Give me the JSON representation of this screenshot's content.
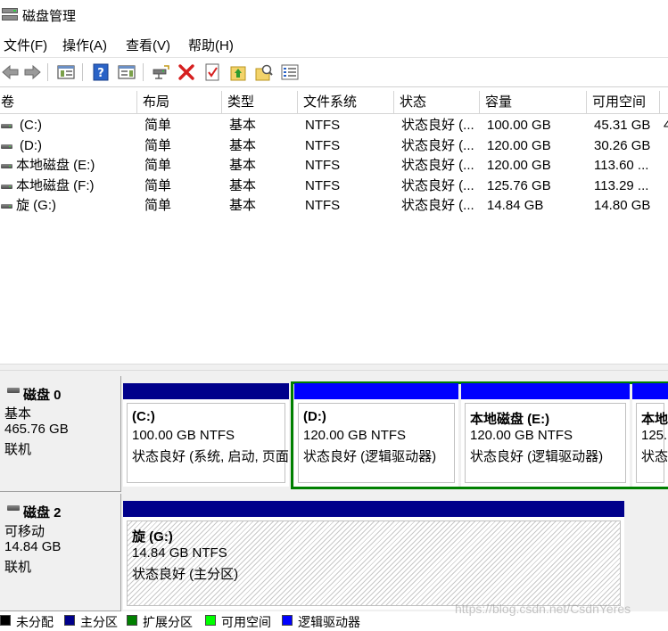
{
  "window": {
    "title": "磁盘管理"
  },
  "menu": [
    "文件(F)",
    "操作(A)",
    "查看(V)",
    "帮助(H)"
  ],
  "toolbar_icons": [
    "back-arrow-icon",
    "forward-arrow-icon",
    "console-tree-icon",
    "help-icon",
    "action-pane-icon",
    "connect-drive-icon",
    "delete-icon",
    "properties-check-icon",
    "up-arrow-folder-icon",
    "search-folder-icon",
    "list-view-icon"
  ],
  "columns": [
    "卷",
    "布局",
    "类型",
    "文件系统",
    "状态",
    "容量",
    "可用空间",
    ""
  ],
  "volumes": [
    {
      "name": "(C:)",
      "layout": "简单",
      "type": "基本",
      "fs": "NTFS",
      "status": "状态良好 (...",
      "capacity": "100.00 GB",
      "free": "45.31 GB",
      "pct": "4"
    },
    {
      "name": "(D:)",
      "layout": "简单",
      "type": "基本",
      "fs": "NTFS",
      "status": "状态良好 (...",
      "capacity": "120.00 GB",
      "free": "30.26 GB",
      "pct": ""
    },
    {
      "name": "本地磁盘 (E:)",
      "layout": "简单",
      "type": "基本",
      "fs": "NTFS",
      "status": "状态良好 (...",
      "capacity": "120.00 GB",
      "free": "113.60 ...",
      "pct": ""
    },
    {
      "name": "本地磁盘 (F:)",
      "layout": "简单",
      "type": "基本",
      "fs": "NTFS",
      "status": "状态良好 (...",
      "capacity": "125.76 GB",
      "free": "113.29 ...",
      "pct": ""
    },
    {
      "name": "旋 (G:)",
      "layout": "简单",
      "type": "基本",
      "fs": "NTFS",
      "status": "状态良好 (...",
      "capacity": "14.84 GB",
      "free": "14.80 GB",
      "pct": ""
    }
  ],
  "disks": [
    {
      "name": "磁盘 0",
      "kind": "基本",
      "size": "465.76 GB",
      "state": "联机",
      "partitions": [
        {
          "label": "(C:)",
          "size": "100.00 GB NTFS",
          "status": "状态良好 (系统, 启动, 页面",
          "bar": "#00008b"
        },
        {
          "label": "(D:)",
          "size": "120.00 GB NTFS",
          "status": "状态良好 (逻辑驱动器)",
          "bar": "#0000ff"
        },
        {
          "label": "本地磁盘 (E:)",
          "size": "120.00 GB NTFS",
          "status": "状态良好 (逻辑驱动器)",
          "bar": "#0000ff"
        },
        {
          "label": "本地",
          "size": "125.",
          "status": "状态",
          "bar": "#0000ff"
        }
      ]
    },
    {
      "name": "磁盘 2",
      "kind": "可移动",
      "size": "14.84 GB",
      "state": "联机",
      "partitions": [
        {
          "label": "旋 (G:)",
          "size": "14.84 GB NTFS",
          "status": "状态良好 (主分区)",
          "bar": "#00008b"
        }
      ]
    }
  ],
  "legend": [
    {
      "label": "未分配",
      "color": "#000000"
    },
    {
      "label": "主分区",
      "color": "#00008b"
    },
    {
      "label": "扩展分区",
      "color": "#008000"
    },
    {
      "label": "可用空间",
      "color": "#00ff00"
    },
    {
      "label": "逻辑驱动器",
      "color": "#0000ff"
    }
  ],
  "watermark": "https://blog.csdn.net/CsdnYeres",
  "colors": {
    "primary": "#00008b",
    "logical": "#0000ff",
    "extended": "#008000",
    "free": "#00ff00"
  }
}
